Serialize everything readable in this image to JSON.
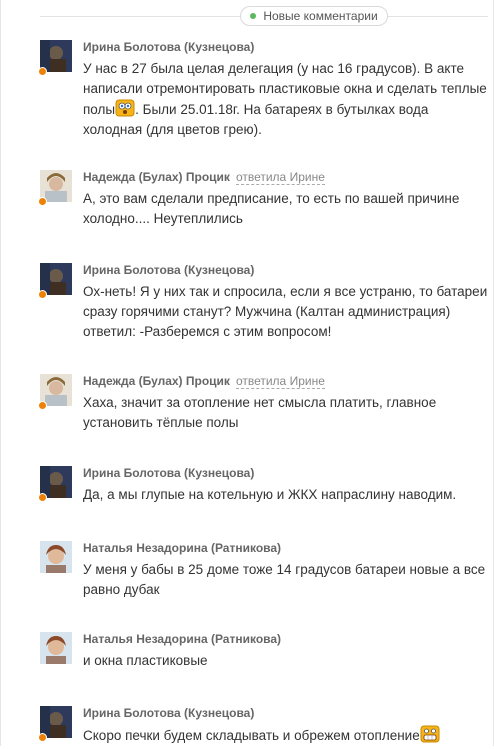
{
  "header": {
    "new_comments_label": "Новые комментарии"
  },
  "comments": [
    {
      "author": "Ирина Болотова (Кузнецова)",
      "reply": "",
      "text_a": "У нас в 27 была целая делегация (у нас 16 градусов). В акте написали отремонтировать пластиковые окна и сделать теплые полы",
      "emoji_a": "surprised-emoji",
      "text_b": ". Были 25.01.18г. На батареях в бутылках вода холодная (для цветов грею).",
      "avatar": "avatar-dark",
      "online": true
    },
    {
      "author": "Надежда (Булах) Процик",
      "reply": "ответила Ирине",
      "text_a": "А, это вам сделали предписание, то есть по вашей причине холодно.... Неутеплились",
      "avatar": "avatar-light",
      "online": true
    },
    {
      "author": "Ирина Болотова (Кузнецова)",
      "reply": "",
      "text_a": "Ох-неть! Я у них так и спросила, если я все устраню, то батареи сразу горячими станут? Мужчина (Калтан администрация) ответил: -Разберемся с этим вопросом!",
      "avatar": "avatar-dark",
      "online": true
    },
    {
      "author": "Надежда (Булах) Процик",
      "reply": "ответила Ирине",
      "text_a": "Хаха, значит за отопление нет смысла платить, главное установить тёплые полы",
      "avatar": "avatar-light",
      "online": true
    },
    {
      "author": "Ирина Болотова (Кузнецова)",
      "reply": "",
      "text_a": "Да, а мы глупые на котельную и ЖКХ напраслину наводим.",
      "avatar": "avatar-dark",
      "online": true
    },
    {
      "author": "Наталья Незадорина (Ратникова)",
      "reply": "",
      "text_a": "У меня у бабы в 25 доме тоже 14 градусов батареи новые а все равно дубак",
      "avatar": "avatar-portrait",
      "online": false
    },
    {
      "author": "Наталья Незадорина (Ратникова)",
      "reply": "",
      "text_a": "и окна пластиковые",
      "avatar": "avatar-portrait",
      "online": false
    },
    {
      "author": "Ирина Болотова (Кузнецова)",
      "reply": "",
      "text_a": "Скоро печки будем складывать и обрежем отопление",
      "emoji_a": "grin-emoji",
      "avatar": "avatar-dark",
      "online": true
    }
  ],
  "colors": {
    "online_dot": "#ee8208",
    "new_dot": "#5cb85c",
    "author": "#666666",
    "text": "#333333"
  }
}
